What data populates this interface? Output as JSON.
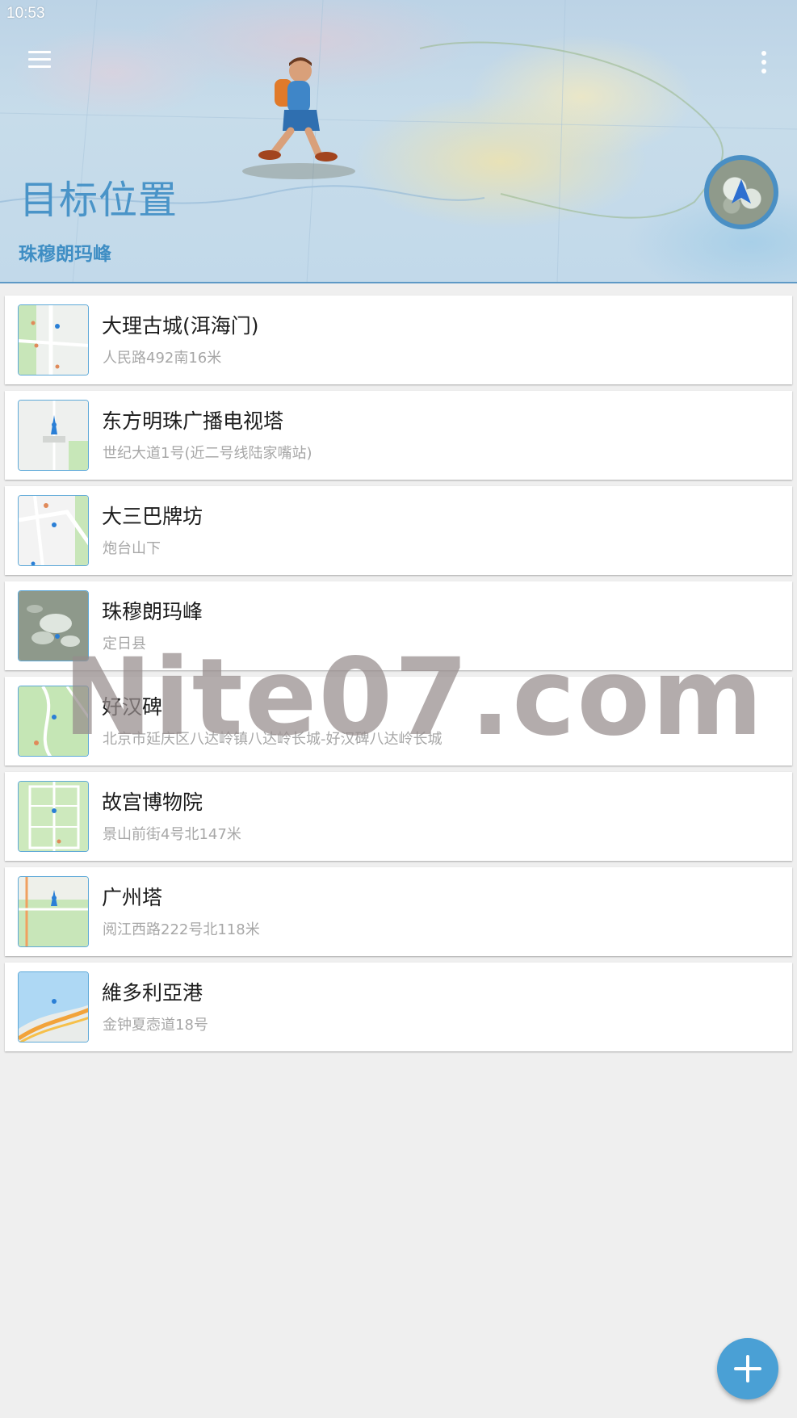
{
  "status_bar": {
    "time": "10:53"
  },
  "header": {
    "title": "目标位置",
    "subtitle": "珠穆朗玛峰",
    "menu_icon": "hamburger-menu-icon",
    "more_icon": "more-vert-icon",
    "accent_color": "#4a94c8"
  },
  "locations": [
    {
      "title": "大理古城(洱海门)",
      "subtitle": "人民路492南16米",
      "thumbnail": "map-thumbnail-street"
    },
    {
      "title": "东方明珠广播电视塔",
      "subtitle": "世纪大道1号(近二号线陆家嘴站)",
      "thumbnail": "map-thumbnail-tower"
    },
    {
      "title": "大三巴牌坊",
      "subtitle": "炮台山下",
      "thumbnail": "map-thumbnail-street"
    },
    {
      "title": "珠穆朗玛峰",
      "subtitle": "定日县",
      "thumbnail": "map-thumbnail-satellite"
    },
    {
      "title": "好汉碑",
      "subtitle": "北京市延庆区八达岭镇八达岭长城-好汉碑八达岭长城",
      "thumbnail": "map-thumbnail-park"
    },
    {
      "title": "故宫博物院",
      "subtitle": "景山前街4号北147米",
      "thumbnail": "map-thumbnail-palace"
    },
    {
      "title": "广州塔",
      "subtitle": "阅江西路222号北118米",
      "thumbnail": "map-thumbnail-park"
    },
    {
      "title": "維多利亞港",
      "subtitle": "金钟夏悫道18号",
      "thumbnail": "map-thumbnail-harbor"
    }
  ],
  "watermark": "Nite07.com",
  "fab": {
    "icon": "plus-icon",
    "color": "#4aa0d5"
  }
}
